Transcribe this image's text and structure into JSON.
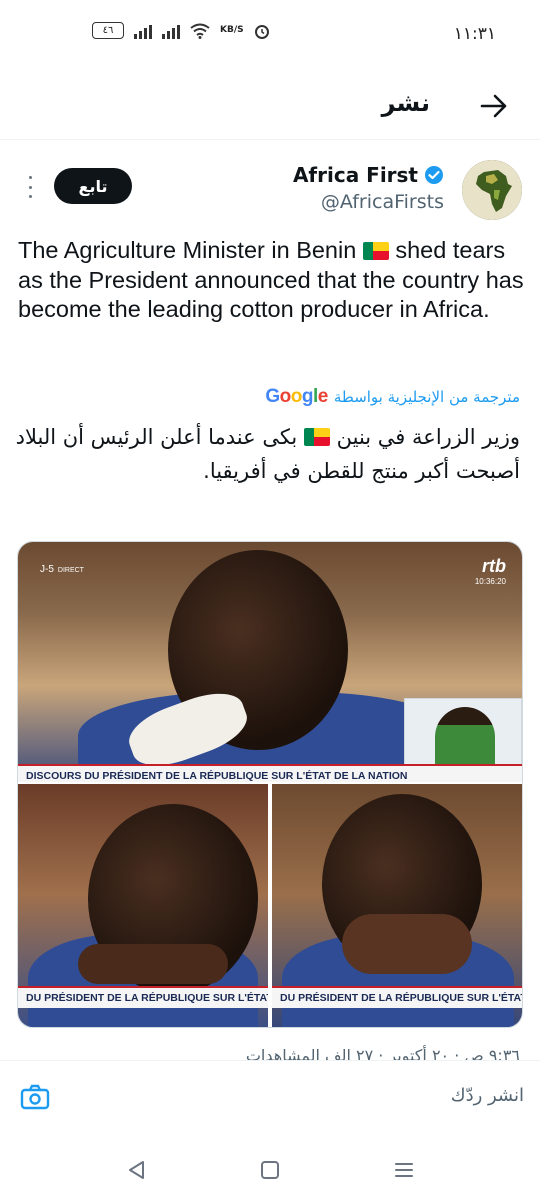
{
  "status_bar": {
    "time": "١١:٣١",
    "battery_level": "٤٦",
    "network_speed": "KB/S"
  },
  "header": {
    "title": "نشر",
    "back_icon": "arrow-right-icon"
  },
  "tweet": {
    "author_name": "Africa First",
    "author_handle": "@AfricaFirsts",
    "verified": true,
    "follow_label": "تابع",
    "text_before_flag": "The Agriculture Minister in Benin ",
    "text_after_flag": " shed tears as the President announced that the country has become the leading cotton producer in Africa.",
    "translated_by": "مترجمة من الإنجليزية بواسطة",
    "translator_logo": "Google",
    "translated_before_flag": "وزير الزراعة في بنين ",
    "translated_after_flag": " بكى عندما أعلن الرئيس أن البلاد أصبحت أكبر منتج للقطن في أفريقيا."
  },
  "media": {
    "top_left_badge": "J-5",
    "top_left_badge_sub": "DIRECT",
    "channel_logo": "rtb",
    "channel_clock": "10:36:20",
    "ticker_top": "DISCOURS DU PRÉSIDENT DE LA RÉPUBLIQUE SUR L'ÉTAT DE LA NATION",
    "ticker_bottom_left": "DU PRÉSIDENT DE LA RÉPUBLIQUE SUR L'ÉTAT DE",
    "ticker_bottom_right": "DU PRÉSIDENT DE LA RÉPUBLIQUE SUR L'ÉTAT DE"
  },
  "stats_row_partial": "٩:٣٦ ص · ٢٠ أكتوبر · ٢٧ الف المشاهدات",
  "reply_bar": {
    "placeholder": "انشر ردّك",
    "camera_icon": "camera-icon"
  },
  "nav_bar": {
    "buttons": [
      "back-triangle-icon",
      "home-square-icon",
      "recents-icon"
    ]
  },
  "colors": {
    "accent": "#1d9bf0",
    "text": "#0f1419",
    "secondary": "#536471",
    "follow_bg": "#0f1419"
  }
}
